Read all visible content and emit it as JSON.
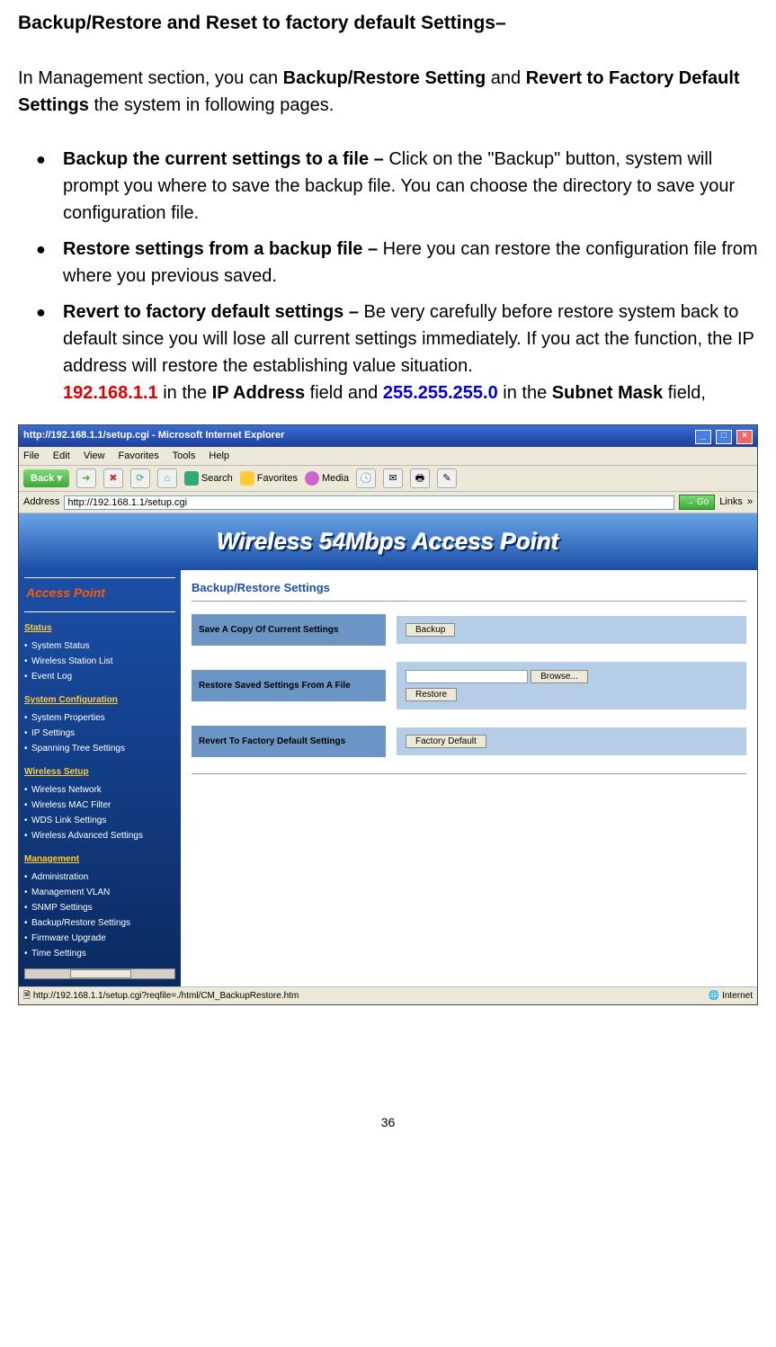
{
  "heading": "Backup/Restore and Reset to factory default Settings–",
  "intro_pre": "In Management section, you can ",
  "intro_b1": "Backup/Restore Setting",
  "intro_mid": " and ",
  "intro_b2": "Revert to Factory Default Settings",
  "intro_post": " the system in following pages.",
  "bullets": {
    "b1_title": "Backup the current settings to a file – ",
    "b1_text": "Click on the \"Backup\" button, system will prompt you where to save the backup file. You can choose the directory to save your configuration file.",
    "b2_title": "Restore settings from a backup file – ",
    "b2_text": "Here you can restore the configuration file from where you previous saved.",
    "b3_title": "Revert to factory default settings – ",
    "b3_text": "Be very carefully before restore system back to default since you will lose all current settings immediately. If you act the function, the IP address will restore the establishing value situation.",
    "b3_ip": "192.168.1.1",
    "b3_mid1": " in the ",
    "b3_ipaddr_label": "IP Address",
    "b3_mid2": " field and ",
    "b3_subnet": "255.255.255.0",
    "b3_mid3": " in the ",
    "b3_subnet_label": "Subnet Mask",
    "b3_end": " field,"
  },
  "browser": {
    "title": "http://192.168.1.1/setup.cgi - Microsoft Internet Explorer",
    "menus": {
      "file": "File",
      "edit": "Edit",
      "view": "View",
      "favorites": "Favorites",
      "tools": "Tools",
      "help": "Help"
    },
    "toolbar": {
      "back": "Back",
      "search": "Search",
      "favorites": "Favorites",
      "media": "Media"
    },
    "address_label": "Address",
    "address_value": "http://192.168.1.1/setup.cgi",
    "go": "Go",
    "links": "Links",
    "banner": "Wireless 54Mbps Access Point",
    "sidebar": {
      "title": "Access Point",
      "status_label": "Status",
      "status": {
        "s1": "System Status",
        "s2": "Wireless Station List",
        "s3": "Event Log"
      },
      "sysconf_label": "System Configuration",
      "sysconf": {
        "c1": "System Properties",
        "c2": "IP Settings",
        "c3": "Spanning Tree Settings"
      },
      "wireless_label": "Wireless Setup",
      "wireless": {
        "w1": "Wireless Network",
        "w2": "Wireless MAC Filter",
        "w3": "WDS Link Settings",
        "w4": "Wireless Advanced Settings"
      },
      "mgmt_label": "Management",
      "mgmt": {
        "m1": "Administration",
        "m2": "Management VLAN",
        "m3": "SNMP Settings",
        "m4": "Backup/Restore Settings",
        "m5": "Firmware Upgrade",
        "m6": "Time Settings"
      }
    },
    "main": {
      "title": "Backup/Restore Settings",
      "row1_label": "Save A Copy Of Current Settings",
      "row1_btn": "Backup",
      "row2_label": "Restore Saved Settings From A File",
      "row2_browse": "Browse...",
      "row2_btn": "Restore",
      "row3_label": "Revert To Factory Default Settings",
      "row3_btn": "Factory Default"
    },
    "status_text": "http://192.168.1.1/setup.cgi?reqfile=./html/CM_BackupRestore.htm",
    "status_zone": "Internet"
  },
  "page_number": "36"
}
